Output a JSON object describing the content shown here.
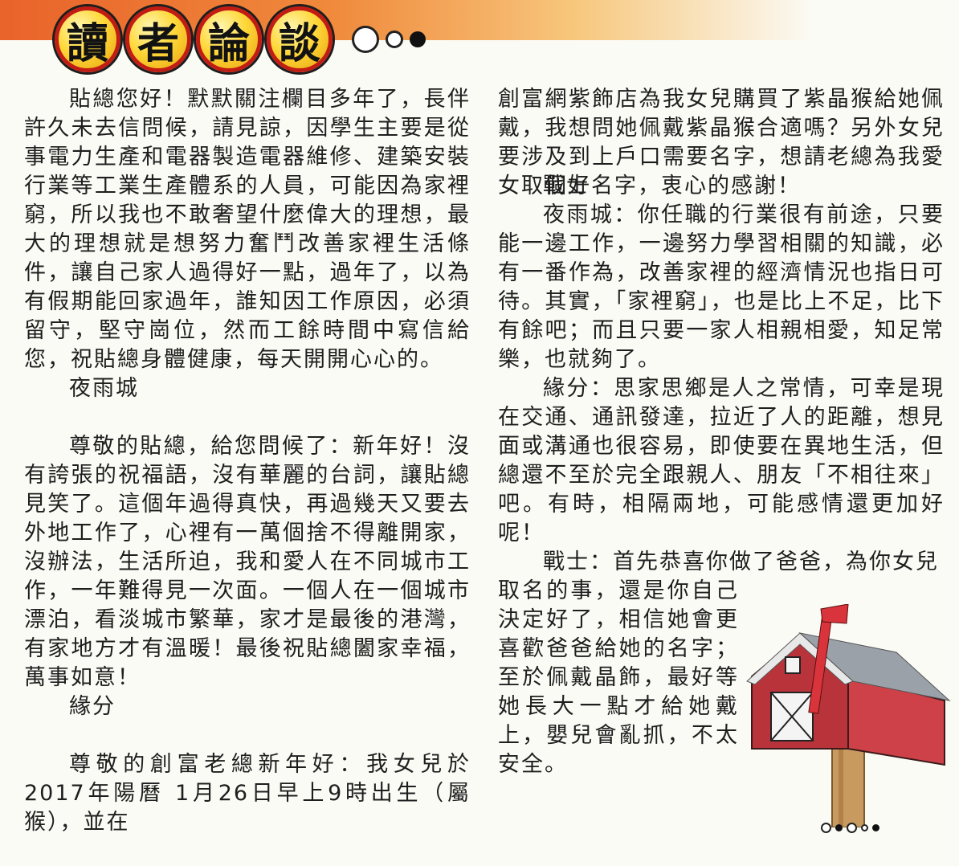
{
  "header": {
    "title_chars": [
      "讀",
      "者",
      "論",
      "談"
    ]
  },
  "left_column": {
    "letter1": {
      "body": "貼總您好！默默關注欄目多年了，長伴許久未去信問候，請見諒，因學生主要是從事電力生產和電器製造電器維修、建築安裝行業等工業生產體系的人員，可能因為家裡窮，所以我也不敢奢望什麼偉大的理想，最大的理想就是想努力奮鬥改善家裡生活條件，讓自己家人過得好一點，過年了，以為有假期能回家過年，誰知因工作原因，必須留守，堅守崗位，然而工餘時間中寫信給您，祝貼總身體健康，每天開開心心的。",
      "signature": "夜雨城"
    },
    "letter2": {
      "body": "尊敬的貼總，給您問候了：新年好！沒有誇張的祝福語，沒有華麗的台詞，讓貼總見笑了。這個年過得真快，再過幾天又要去外地工作了，心裡有一萬個捨不得離開家，沒辦法，生活所迫，我和愛人在不同城市工作，一年難得見一次面。一個人在一個城市漂泊，看淡城市繁華，家才是最後的港灣，有家地方才有溫暖！最後祝貼總闔家幸福，萬事如意！",
      "signature": "緣分"
    },
    "letter3_start": "尊敬的創富老總新年好：我女兒於2017年陽曆 1月26日早上9時出生（屬猴），並在"
  },
  "right_column": {
    "letter3_end": "創富網紫飾店為我女兒購買了紫晶猴給她佩戴，我想問她佩戴紫晶猴合適嗎？另外女兒要涉及到上戶口需要名字，想請老總為我愛女取個好名字，衷心的感謝！",
    "letter3_signature": "戰士",
    "reply1": "夜雨城：你任職的行業很有前途，只要能一邊工作，一邊努力學習相關的知識，必有一番作為，改善家裡的經濟情況也指日可待。其實，「家裡窮」，也是比上不足，比下有餘吧；而且只要一家人相親相愛，知足常樂，也就夠了。",
    "reply2": "緣分：思家思鄉是人之常情，可幸是現在交通、通訊發達，拉近了人的距離，想見面或溝通也很容易，即使要在異地生活，但總還不至於完全跟親人、朋友「不相往來」吧。有時，相隔兩地，可能感情還更加好呢！",
    "reply3_first_line": "戰士：首先恭喜你做了爸爸，為你女兒",
    "reply3_rest": "取名的事，還是你自己決定好了，相信她會更喜歡爸爸給她的名字；至於佩戴晶飾，最好等她長大一點才給她戴上，嬰兒會亂抓，不太安全。"
  },
  "colors": {
    "top_band": "#e9632a",
    "title_circle": "#ffd83a",
    "title_border": "#c21d14",
    "mailbox_red": "#c9323a",
    "mailbox_roof": "#9aa1a8"
  }
}
